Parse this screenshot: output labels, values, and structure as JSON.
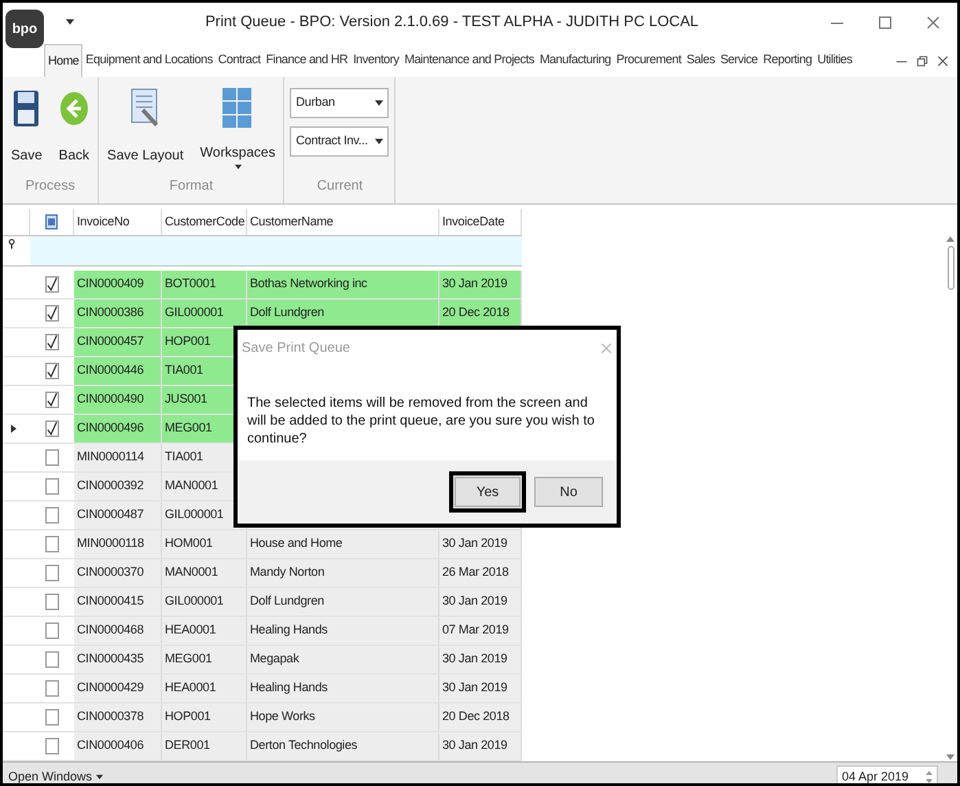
{
  "window": {
    "title": "Print Queue - BPO: Version 2.1.0.69 - TEST ALPHA - JUDITH PC LOCAL",
    "logo": "bpo"
  },
  "tabs": [
    {
      "label": "Home",
      "selected": true
    },
    {
      "label": "Equipment and Locations",
      "selected": false
    },
    {
      "label": "Contract",
      "selected": false
    },
    {
      "label": "Finance and HR",
      "selected": false
    },
    {
      "label": "Inventory",
      "selected": false
    },
    {
      "label": "Maintenance and Projects",
      "selected": false
    },
    {
      "label": "Manufacturing",
      "selected": false
    },
    {
      "label": "Procurement",
      "selected": false
    },
    {
      "label": "Sales",
      "selected": false
    },
    {
      "label": "Service",
      "selected": false
    },
    {
      "label": "Reporting",
      "selected": false
    },
    {
      "label": "Utilities",
      "selected": false
    }
  ],
  "ribbon": {
    "groups": [
      {
        "label": "Process",
        "items": [
          {
            "kind": "save",
            "label": "Save"
          },
          {
            "kind": "back",
            "label": "Back"
          }
        ]
      },
      {
        "label": "Format",
        "items": [
          {
            "kind": "layout",
            "label": "Save Layout"
          },
          {
            "kind": "workspaces",
            "label": "Workspaces"
          }
        ]
      },
      {
        "label": "Current",
        "items": [
          {
            "kind": "dropdown",
            "label": "Durban"
          },
          {
            "kind": "dropdown",
            "label": "Contract Inv..."
          }
        ]
      }
    ]
  },
  "table": {
    "select_all": {
      "indeterminate": true
    },
    "columns": [
      "InvoiceNo",
      "CustomerCode",
      "CustomerName",
      "InvoiceDate"
    ],
    "rows": [
      {
        "checked": true,
        "current": false,
        "invoice_no": "CIN0000409",
        "customer_code": "BOT0001",
        "customer_name": "Bothas Networking inc",
        "invoice_date": "30 Jan 2019"
      },
      {
        "checked": true,
        "current": false,
        "invoice_no": "CIN0000386",
        "customer_code": "GIL000001",
        "customer_name": "Dolf Lundgren",
        "invoice_date": "20 Dec 2018"
      },
      {
        "checked": true,
        "current": false,
        "invoice_no": "CIN0000457",
        "customer_code": "HOP001"
      },
      {
        "checked": true,
        "current": false,
        "invoice_no": "CIN0000446",
        "customer_code": "TIA001"
      },
      {
        "checked": true,
        "current": false,
        "invoice_no": "CIN0000490",
        "customer_code": "JUS001"
      },
      {
        "checked": true,
        "current": true,
        "invoice_no": "CIN0000496",
        "customer_code": "MEG001"
      },
      {
        "checked": false,
        "current": false,
        "invoice_no": "MIN0000114",
        "customer_code": "TIA001"
      },
      {
        "checked": false,
        "current": false,
        "invoice_no": "CIN0000392",
        "customer_code": "MAN0001"
      },
      {
        "checked": false,
        "current": false,
        "invoice_no": "CIN0000487",
        "customer_code": "GIL000001"
      },
      {
        "checked": false,
        "current": false,
        "invoice_no": "MIN0000118",
        "customer_code": "HOM001",
        "customer_name": "House and Home",
        "invoice_date": "30 Jan 2019"
      },
      {
        "checked": false,
        "current": false,
        "invoice_no": "CIN0000370",
        "customer_code": "MAN0001",
        "customer_name": "Mandy Norton",
        "invoice_date": "26 Mar 2018"
      },
      {
        "checked": false,
        "current": false,
        "invoice_no": "CIN0000415",
        "customer_code": "GIL000001",
        "customer_name": "Dolf Lundgren",
        "invoice_date": "30 Jan 2019"
      },
      {
        "checked": false,
        "current": false,
        "invoice_no": "CIN0000468",
        "customer_code": "HEA0001",
        "customer_name": "Healing Hands",
        "invoice_date": "07 Mar 2019"
      },
      {
        "checked": false,
        "current": false,
        "invoice_no": "CIN0000435",
        "customer_code": "MEG001",
        "customer_name": "Megapak",
        "invoice_date": "30 Jan 2019"
      },
      {
        "checked": false,
        "current": false,
        "invoice_no": "CIN0000429",
        "customer_code": "HEA0001",
        "customer_name": "Healing Hands",
        "invoice_date": "30 Jan 2019"
      },
      {
        "checked": false,
        "current": false,
        "invoice_no": "CIN0000378",
        "customer_code": "HOP001",
        "customer_name": "Hope Works",
        "invoice_date": "20 Dec 2018"
      },
      {
        "checked": false,
        "current": false,
        "invoice_no": "CIN0000406",
        "customer_code": "DER001",
        "customer_name": "Derton Technologies",
        "invoice_date": "30 Jan 2019"
      }
    ]
  },
  "dialog": {
    "title": "Save Print Queue",
    "message": "The selected items will be removed from the screen and will be added to the print queue, are you sure you wish to continue?",
    "buttons": [
      {
        "label": "Yes",
        "selected": true
      },
      {
        "label": "No",
        "selected": false
      }
    ]
  },
  "status_bar": {
    "open_windows": "Open Windows",
    "date": "04 Apr 2019"
  }
}
